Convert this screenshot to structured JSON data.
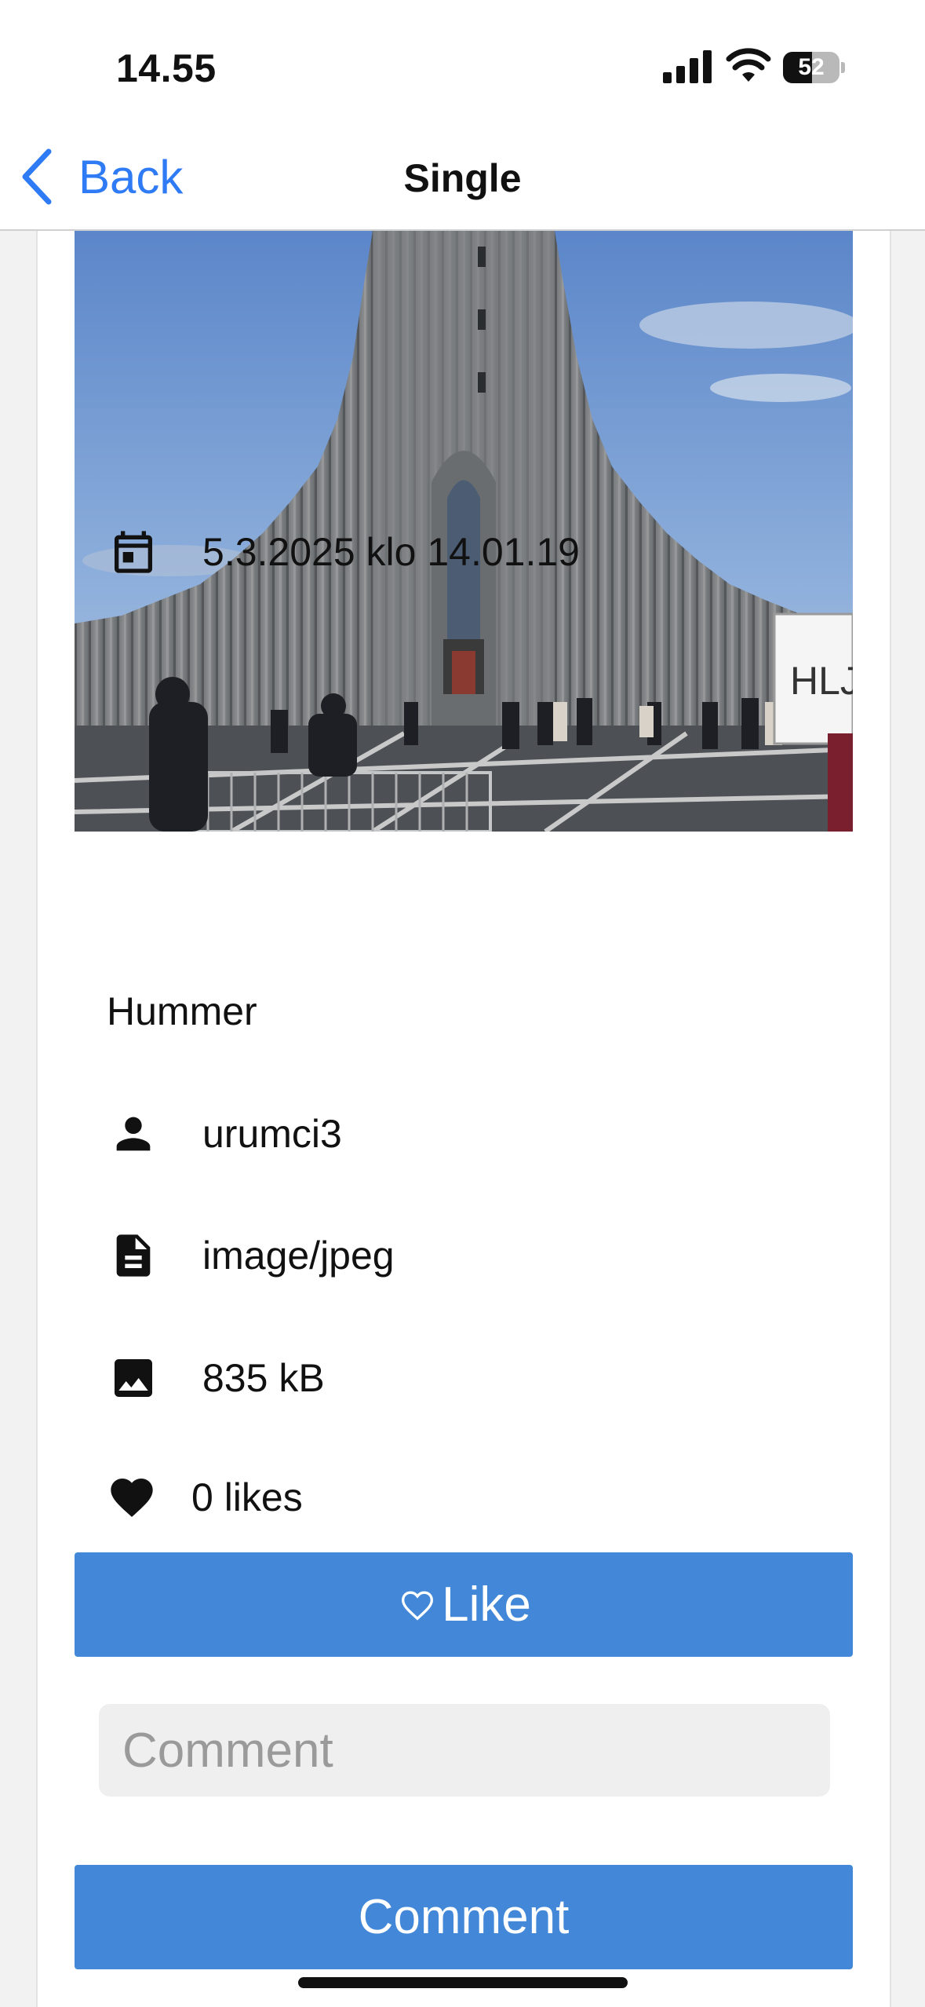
{
  "status_bar": {
    "time": "14.55",
    "battery_level": "52",
    "battery_fraction": 0.52
  },
  "nav": {
    "back_label": "Back",
    "title": "Single"
  },
  "photo": {
    "alt": "Hallgrímskirkja church photo",
    "sign_text": "HLJ"
  },
  "details": {
    "date": "5.3.2025 klo 14.01.19",
    "title": "Hummer",
    "user": "urumci3",
    "mime_type": "image/jpeg",
    "size": "835 kB",
    "likes": "0 likes"
  },
  "actions": {
    "like_label": "Like",
    "comment_placeholder": "Comment",
    "comment_button_label": "Comment"
  },
  "icons": {
    "back": "chevron-left-icon",
    "date": "calendar-icon",
    "user": "person-icon",
    "mime": "file-icon",
    "size": "image-icon",
    "likes": "heart-icon",
    "like_button": "heart-outline-icon"
  },
  "colors": {
    "accent": "#2f7bf6",
    "button": "#4388d8",
    "input_bg": "#efefef"
  }
}
